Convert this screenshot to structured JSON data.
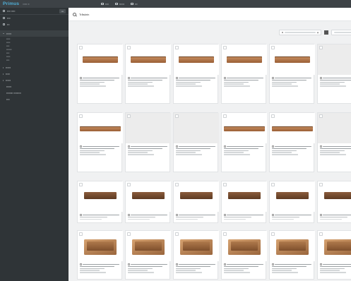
{
  "app": {
    "title": "Primus"
  },
  "search": {
    "value": "Tråskrin"
  },
  "rows": [
    {
      "variant": "flat"
    },
    {
      "variant": "long"
    },
    {
      "variant": "dark"
    },
    {
      "variant": "tray"
    }
  ],
  "grey_thumbs": [
    [
      0,
      5
    ],
    [
      1,
      1
    ],
    [
      1,
      2
    ],
    [
      1,
      5
    ]
  ],
  "icons": {
    "search": "search-icon",
    "grid": "grid-view-icon",
    "sidebar_item": "folder-icon",
    "expand": "chevron-right-icon",
    "collapse": "chevron-down-icon",
    "select": "checkbox-icon"
  }
}
